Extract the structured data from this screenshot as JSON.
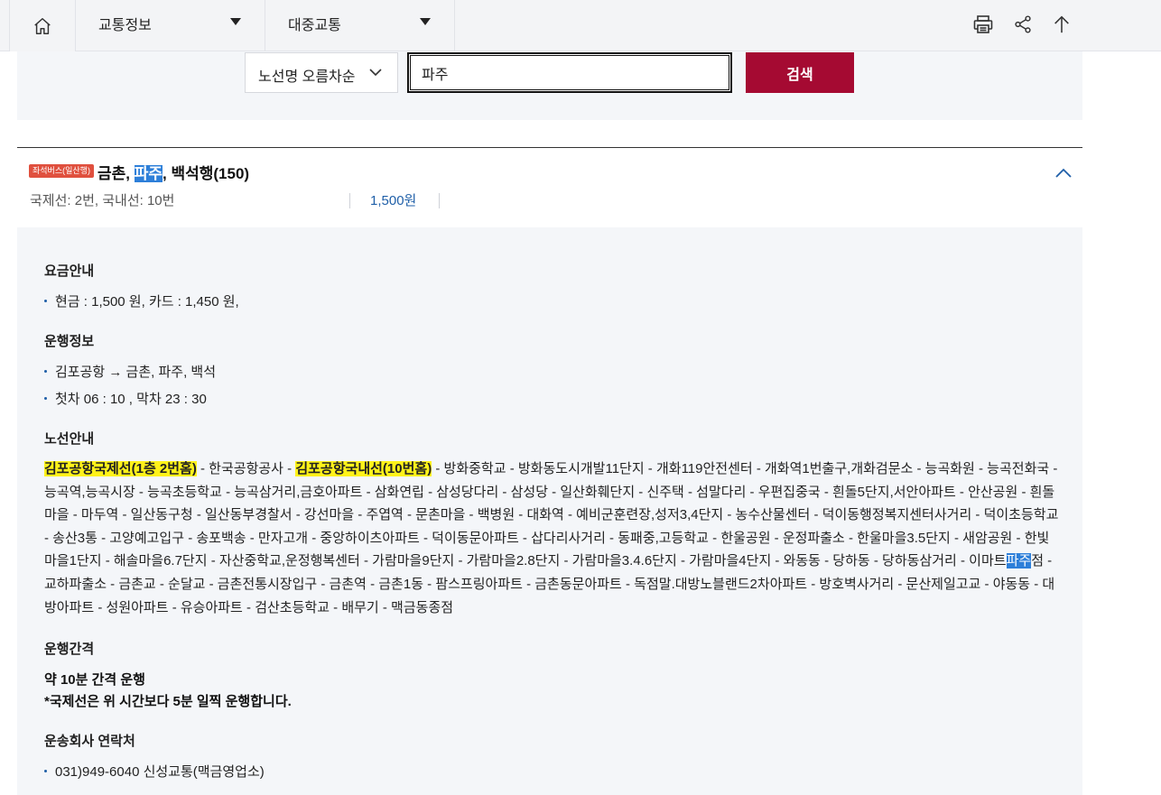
{
  "topbar": {
    "menu1": "교통정보",
    "menu2": "대중교통"
  },
  "search": {
    "sort_label": "노선명 오름차순",
    "query": "파주",
    "button": "검색"
  },
  "route": {
    "badge": "좌석버스(일산행)",
    "title_before": "금촌, ",
    "title_highlight": "파주",
    "title_after": ", 백석행(150)",
    "subtitle": "국제선: 2번, 국내선: 10번",
    "fare": "1,500원"
  },
  "detail": {
    "fare_title": "요금안내",
    "fare_item": "현금 : 1,500 원, 카드 : 1,450 원,",
    "operation_title": "운행정보",
    "operation_items": [
      "김포공항 → 금촌, 파주, 백석",
      "첫차 06 : 10 , 막차 23 : 30"
    ],
    "route_title": "노선안내",
    "stops_hl1": "김포공항국제선(1층 2번홈)",
    "stops_mid1": " - 한국공항공사 - ",
    "stops_hl2": "김포공항국내선(10번홈)",
    "stops_mid2": " - 방화중학교 - 방화동도시개발11단지 - 개화119안전센터 - 개화역1번출구,개화검문소 - 능곡화원 - 능곡전화국 - 능곡역,능곡시장 - 능곡초등학교 - 능곡삼거리,금호아파트 - 삼화연립 - 삼성당다리 - 삼성당 - 일산화훼단지 - 신주택 - 섬말다리 - 우편집중국 - 흰돌5단지,서안아파트 - 안산공원 - 흰돌마을 - 마두역 - 일산동구청 - 일산동부경찰서 - 강선마을 - 주엽역 - 문촌마을 - 백병원 - 대화역 - 예비군훈련장,성저3,4단지 - 농수산물센터 - 덕이동행정복지센터사거리 - 덕이초등학교 - 송산3통 - 고양예고입구 - 송포백송 - 만자고개 - 중앙하이츠아파트 - 덕이동문아파트 - 삽다리사거리 - 동패중,고등학교 - 한울공원 - 운정파출소 - 한울마을3.5단지 - 새암공원 - 한빛마을1단지 - 해솔마을6.7단지 - 자산중학교,운정행복센터 - 가람마을9단지 - 가람마을2.8단지 - 가람마을3.4.6단지 - 가람마을4단지 - 와동동 - 당하동 - 당하동삼거리 - 이마트",
    "stops_sel": "파주",
    "stops_end": "점 - 교하파출소 - 금촌교 - 순달교 - 금촌전통시장입구 - 금촌역 - 금촌1동 - 팜스프링아파트 - 금촌동문아파트 - 독점말.대방노블랜드2차아파트 - 방호벽사거리 - 문산제일고교 - 야동동 - 대방아파트 - 성원아파트 - 유승아파트 - 검산초등학교 - 배무기 - 맥금동종점",
    "interval_title": "운행간격",
    "interval_line1": "약 10분 간격 운행",
    "interval_line2": "*국제선은 위 시간보다 5분 일찍 운행합니다.",
    "contact_title": "운송회사 연락처",
    "contact_item": "031)949-6040 신성교통(맥금영업소)"
  }
}
